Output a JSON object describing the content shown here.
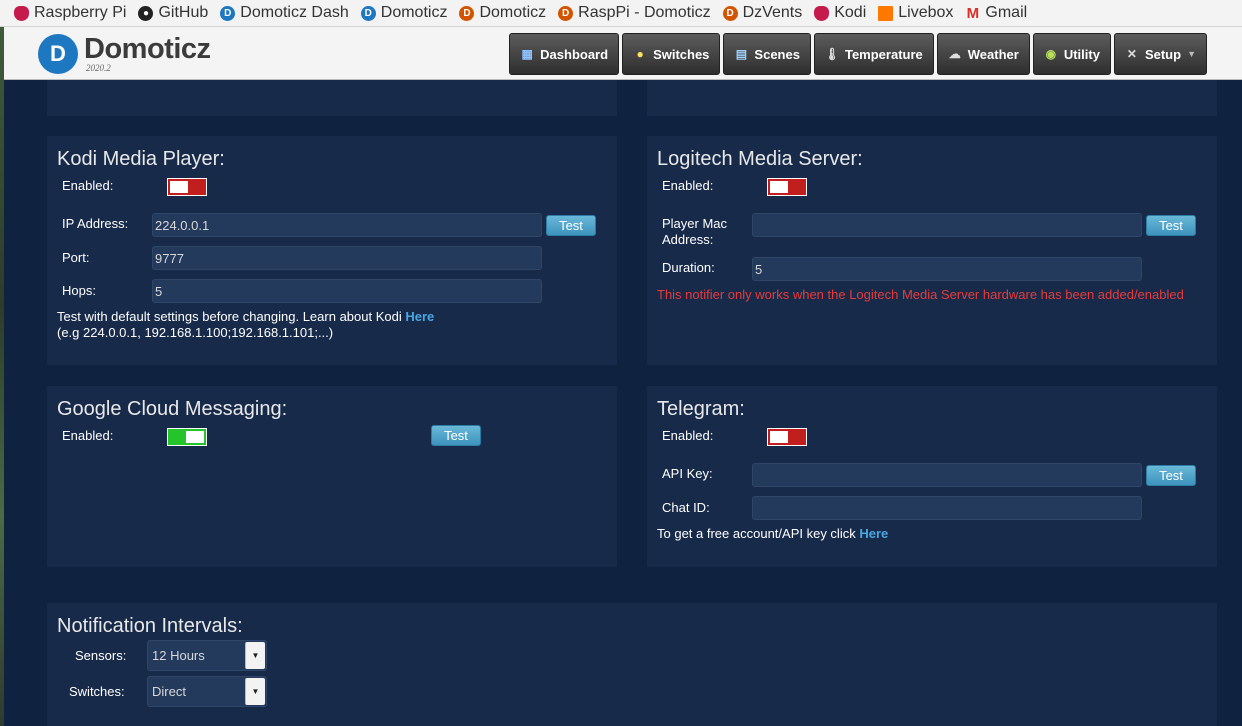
{
  "bookmarks": [
    {
      "label": "Raspberry Pi",
      "icon": "raspberry-icon"
    },
    {
      "label": "GitHub",
      "icon": "github-icon"
    },
    {
      "label": "Domoticz Dash",
      "icon": "domoticz-icon"
    },
    {
      "label": "Domoticz",
      "icon": "domoticz-icon"
    },
    {
      "label": "Domoticz",
      "icon": "domoticz-orange-icon"
    },
    {
      "label": "RaspPi - Domoticz",
      "icon": "domoticz-orange-icon"
    },
    {
      "label": "DzVents",
      "icon": "domoticz-orange-icon"
    },
    {
      "label": "Kodi",
      "icon": "raspberry-icon"
    },
    {
      "label": "Livebox",
      "icon": "orange-icon"
    },
    {
      "label": "Gmail",
      "icon": "gmail-icon"
    }
  ],
  "header": {
    "brand": "Domoticz",
    "version": "2020.2",
    "nav": [
      {
        "label": "Dashboard",
        "icon": "dashboard-icon"
      },
      {
        "label": "Switches",
        "icon": "lightbulb-icon"
      },
      {
        "label": "Scenes",
        "icon": "scenes-icon"
      },
      {
        "label": "Temperature",
        "icon": "thermometer-icon"
      },
      {
        "label": "Weather",
        "icon": "weather-icon"
      },
      {
        "label": "Utility",
        "icon": "utility-icon"
      },
      {
        "label": "Setup",
        "icon": "tools-icon"
      }
    ]
  },
  "kodi": {
    "title": "Kodi Media Player:",
    "enabled_label": "Enabled:",
    "enabled": false,
    "ip_label": "IP Address:",
    "ip_value": "224.0.0.1",
    "port_label": "Port:",
    "port_value": "9777",
    "hops_label": "Hops:",
    "hops_value": "5",
    "test_label": "Test",
    "note1": "Test with default settings before changing. Learn about Kodi ",
    "note_link": "Here",
    "note2": "(e.g 224.0.0.1, 192.168.1.100;192.168.1.101;...)"
  },
  "logitech": {
    "title": "Logitech Media Server:",
    "enabled_label": "Enabled:",
    "enabled": false,
    "mac_label_1": "Player Mac",
    "mac_label_2": "Address:",
    "mac_value": "",
    "duration_label": "Duration:",
    "duration_value": "5",
    "test_label": "Test",
    "warning": "This notifier only works when the Logitech Media Server hardware has been added/enabled"
  },
  "gcm": {
    "title": "Google Cloud Messaging:",
    "enabled_label": "Enabled:",
    "enabled": true,
    "test_label": "Test"
  },
  "telegram": {
    "title": "Telegram:",
    "enabled_label": "Enabled:",
    "enabled": false,
    "api_label": "API Key:",
    "api_value": "",
    "chat_label": "Chat ID:",
    "chat_value": "",
    "test_label": "Test",
    "note": "To get a free account/API key click ",
    "note_link": "Here"
  },
  "intervals": {
    "title": "Notification Intervals:",
    "sensors_label": "Sensors:",
    "sensors_value": "12 Hours",
    "switches_label": "Switches:",
    "switches_value": "Direct"
  },
  "colors": {
    "panel_bg": "#172a4a",
    "page_bg": "#0f2240",
    "toggle_off": "#c11e1e",
    "toggle_on": "#25c42a",
    "link": "#4aa6e0",
    "warning": "#e83a3a"
  }
}
